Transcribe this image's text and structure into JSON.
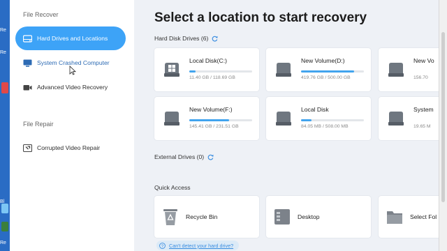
{
  "desktop": {
    "labels": [
      "Re",
      "Re",
      "Bl",
      "Re"
    ]
  },
  "sidebar": {
    "recover_section": "File Recover",
    "repair_section": "File Repair",
    "items": [
      {
        "label": "Hard Drives and Locations",
        "icon": "hard-drive-icon",
        "active": true
      },
      {
        "label": "System Crashed Computer",
        "icon": "monitor-icon",
        "active": false
      },
      {
        "label": "Advanced Video Recovery",
        "icon": "video-camera-icon",
        "active": false
      },
      {
        "label": "Corrupted Video Repair",
        "icon": "video-repair-icon",
        "active": false
      }
    ]
  },
  "main": {
    "title": "Select a location to start recovery",
    "hard_disk": {
      "label": "Hard Disk Drives (6)",
      "drives": [
        {
          "name": "Local Disk(C:)",
          "size": "11.40 GB / 118.69 GB",
          "used": 0.096,
          "windows": true
        },
        {
          "name": "New Volume(D:)",
          "size": "419.76 GB / 500.00 GB",
          "used": 0.84,
          "windows": false
        },
        {
          "name": "New Vo",
          "size": "156.70",
          "used": 0.5,
          "windows": false
        },
        {
          "name": "New Volume(F:)",
          "size": "145.41 GB / 231.51 GB",
          "used": 0.63,
          "windows": false
        },
        {
          "name": "Local Disk",
          "size": "84.05 MB / 508.00 MB",
          "used": 0.17,
          "windows": false
        },
        {
          "name": "System",
          "size": "19.65 M",
          "used": 0.4,
          "windows": false
        }
      ]
    },
    "external": {
      "label": "External Drives (0)"
    },
    "quick_access": {
      "label": "Quick Access",
      "items": [
        {
          "label": "Recycle Bin",
          "icon": "recycle-bin-icon"
        },
        {
          "label": "Desktop",
          "icon": "desktop-icon"
        },
        {
          "label": "Select Fol",
          "icon": "folder-icon"
        }
      ]
    },
    "help_link": "Can't detect your hard drive?"
  },
  "colors": {
    "accent": "#3da3f7",
    "bar_fill": "#42a4ee",
    "background": "#eef1f6"
  }
}
